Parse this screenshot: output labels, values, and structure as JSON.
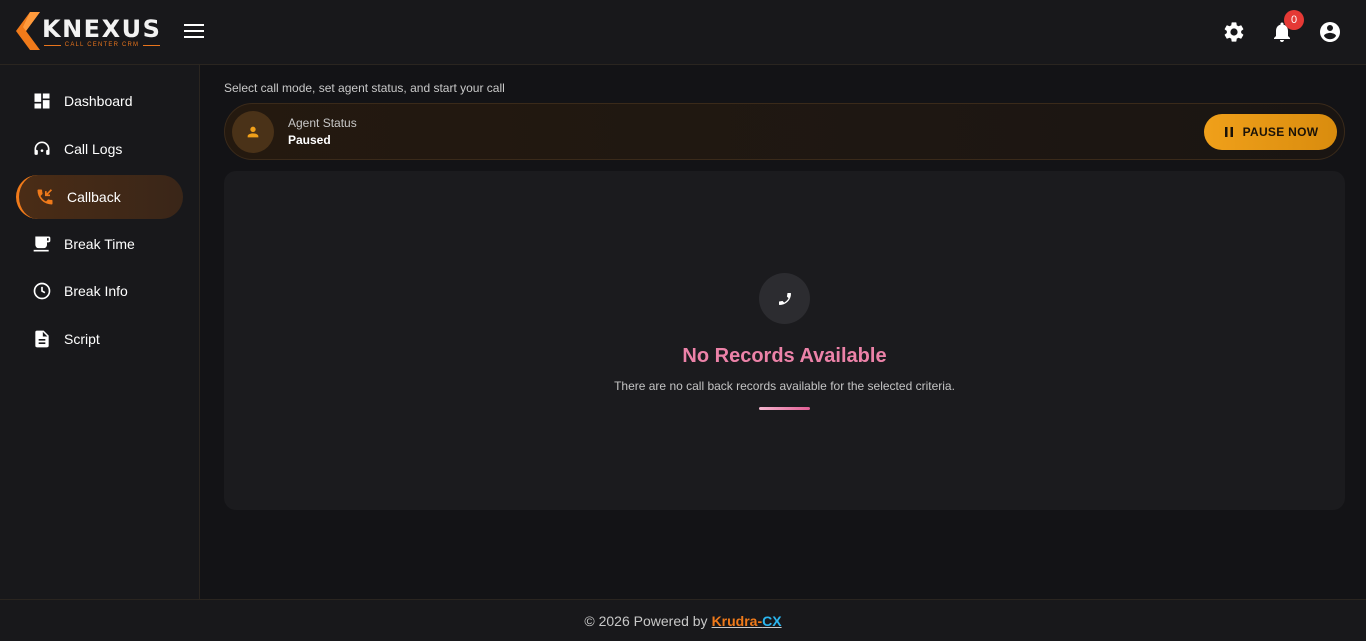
{
  "app": {
    "logo_text": "KNEXUS",
    "logo_subtitle": "CALL CENTER CRM",
    "notification_count": "0"
  },
  "header": {
    "icons": [
      "menu-icon",
      "gear-icon",
      "bell-icon",
      "account-icon"
    ]
  },
  "sidebar": {
    "items": [
      {
        "label": "Dashboard",
        "icon": "dashboard-icon",
        "active": false
      },
      {
        "label": "Call Logs",
        "icon": "headset-icon",
        "active": false
      },
      {
        "label": "Callback",
        "icon": "phone-callback-icon",
        "active": true
      },
      {
        "label": "Break Time",
        "icon": "coffee-icon",
        "active": false
      },
      {
        "label": "Break Info",
        "icon": "clock-icon",
        "active": false
      },
      {
        "label": "Script",
        "icon": "document-icon",
        "active": false
      }
    ]
  },
  "main": {
    "instruction": "Select call mode, set agent status, and start your call",
    "agent_status_label": "Agent Status",
    "agent_status_value": "Paused",
    "pause_button_label": "PAUSE NOW",
    "empty_title": "No Records Available",
    "empty_description": "There are no call back records available for the selected criteria."
  },
  "footer": {
    "prefix": "© 2026 Powered by",
    "brand_part1": "Krudra",
    "brand_separator": "-",
    "brand_part2": "CX"
  },
  "colors": {
    "accent": "#f07a1a",
    "pause_button": "#f0a01a",
    "empty_title": "#ec82a8",
    "brand_cx": "#2bb6f0",
    "notification_badge": "#e53935"
  }
}
